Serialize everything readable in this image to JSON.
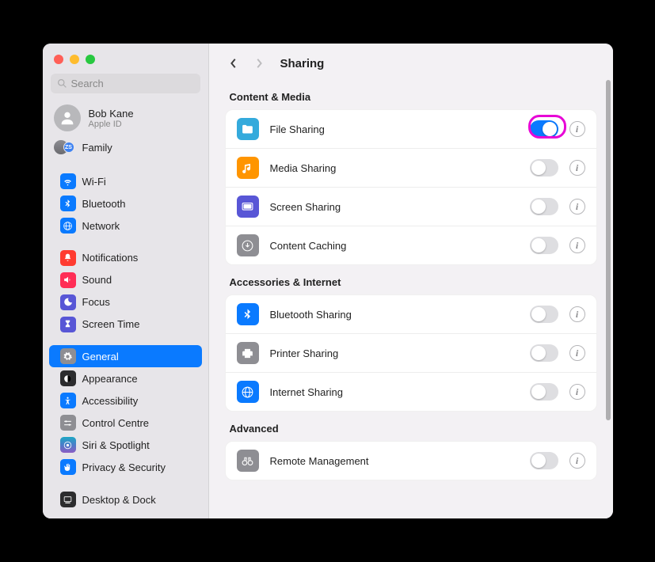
{
  "search": {
    "placeholder": "Search"
  },
  "user": {
    "name": "Bob Kane",
    "sub": "Apple ID"
  },
  "family": {
    "label": "Family",
    "badge": "ZS"
  },
  "sidebar": {
    "group1": [
      {
        "label": "Wi-Fi",
        "icon": "wifi",
        "color": "blue"
      },
      {
        "label": "Bluetooth",
        "icon": "bluetooth",
        "color": "blue"
      },
      {
        "label": "Network",
        "icon": "globe",
        "color": "blue"
      }
    ],
    "group2": [
      {
        "label": "Notifications",
        "icon": "bell",
        "color": "red"
      },
      {
        "label": "Sound",
        "icon": "speaker",
        "color": "pink"
      },
      {
        "label": "Focus",
        "icon": "moon",
        "color": "indigo"
      },
      {
        "label": "Screen Time",
        "icon": "hourglass",
        "color": "indigo"
      }
    ],
    "group3": [
      {
        "label": "General",
        "icon": "gear",
        "color": "gray",
        "selected": true
      },
      {
        "label": "Appearance",
        "icon": "appearance",
        "color": "dark"
      },
      {
        "label": "Accessibility",
        "icon": "accessibility",
        "color": "blue"
      },
      {
        "label": "Control Centre",
        "icon": "controls",
        "color": "gray"
      },
      {
        "label": "Siri & Spotlight",
        "icon": "siri",
        "color": "teal"
      },
      {
        "label": "Privacy & Security",
        "icon": "hand",
        "color": "blue"
      }
    ],
    "group4": [
      {
        "label": "Desktop & Dock",
        "icon": "dock",
        "color": "dark"
      }
    ]
  },
  "header": {
    "title": "Sharing"
  },
  "sections": [
    {
      "title": "Content & Media",
      "items": [
        {
          "label": "File Sharing",
          "icon": "folder",
          "color": "lightblue",
          "on": true,
          "highlight": true
        },
        {
          "label": "Media Sharing",
          "icon": "music",
          "color": "orange",
          "on": false
        },
        {
          "label": "Screen Sharing",
          "icon": "screen",
          "color": "indigo",
          "on": false
        },
        {
          "label": "Content Caching",
          "icon": "download",
          "color": "gray",
          "on": false
        }
      ]
    },
    {
      "title": "Accessories & Internet",
      "items": [
        {
          "label": "Bluetooth Sharing",
          "icon": "bluetooth",
          "color": "blue",
          "on": false
        },
        {
          "label": "Printer Sharing",
          "icon": "printer",
          "color": "gray",
          "on": false
        },
        {
          "label": "Internet Sharing",
          "icon": "globe",
          "color": "blue",
          "on": false
        }
      ]
    },
    {
      "title": "Advanced",
      "items": [
        {
          "label": "Remote Management",
          "icon": "binoculars",
          "color": "gray",
          "on": false
        }
      ]
    }
  ]
}
